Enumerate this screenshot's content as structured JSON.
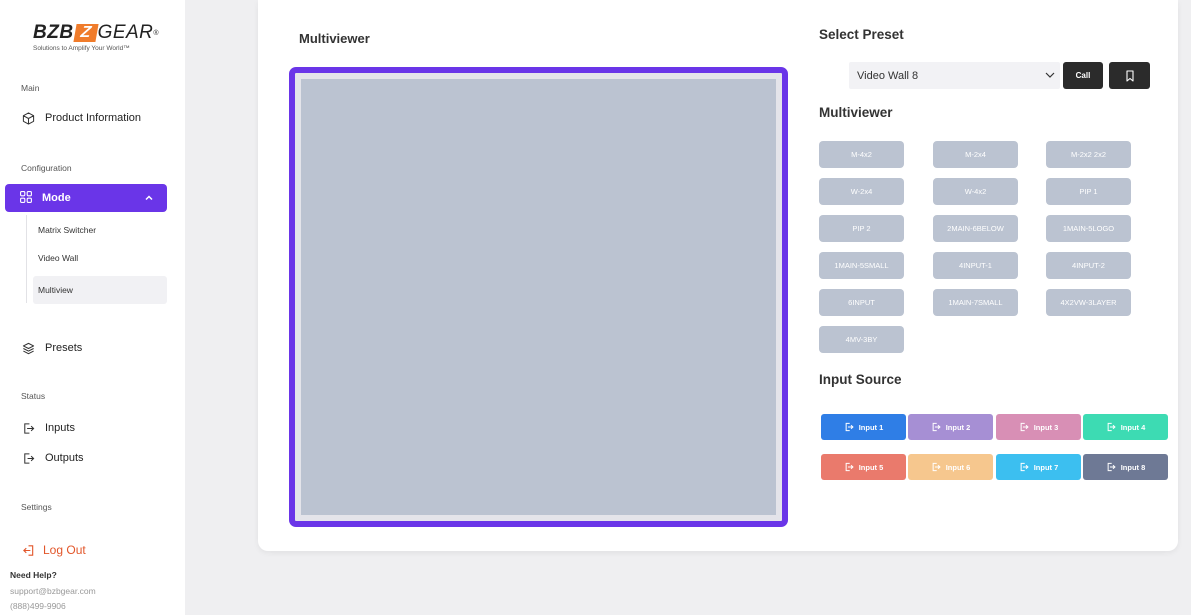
{
  "brand": {
    "logo_left": "BZB",
    "logo_z": "Z",
    "logo_right": "GEAR",
    "logo_reg": "®",
    "tagline": "Solutions to Amplify Your World™"
  },
  "sidebar": {
    "sections": {
      "main": "Main",
      "configuration": "Configuration",
      "status": "Status",
      "settings": "Settings"
    },
    "product_information": "Product Information",
    "mode": "Mode",
    "mode_children": [
      "Matrix Switcher",
      "Video Wall",
      "Multiview"
    ],
    "active_child": "Multiview",
    "presets": "Presets",
    "inputs": "Inputs",
    "outputs": "Outputs",
    "logout": "Log Out",
    "help": {
      "title": "Need Help?",
      "email": "support@bzbgear.com",
      "phone": "(888)499-9906"
    }
  },
  "main": {
    "multiviewer_title": "Multiviewer",
    "select_preset_title": "Select Preset",
    "preset_value": "Video Wall 8",
    "call_label": "Call",
    "multiviewer_section_title": "Multiviewer",
    "layouts": [
      "M-4x2",
      "M-2x4",
      "M-2x2 2x2",
      "W-2x4",
      "W-4x2",
      "PIP 1",
      "PIP 2",
      "2MAIN-6BELOW",
      "1MAIN-5LOGO",
      "1MAIN-5SMALL",
      "4INPUT-1",
      "4INPUT-2",
      "6INPUT",
      "1MAIN-7SMALL",
      "4X2VW-3LAYER",
      "4MV-3BY"
    ],
    "input_source_title": "Input Source",
    "inputs": [
      {
        "label": "Input 1",
        "color": "#2f7ee6"
      },
      {
        "label": "Input 2",
        "color": "#a68fd4"
      },
      {
        "label": "Input 3",
        "color": "#d88fb5"
      },
      {
        "label": "Input 4",
        "color": "#3ddbb3"
      },
      {
        "label": "Input 5",
        "color": "#ea7a6c"
      },
      {
        "label": "Input 6",
        "color": "#f6c78e"
      },
      {
        "label": "Input 7",
        "color": "#3cbff0"
      },
      {
        "label": "Input 8",
        "color": "#6e7995"
      }
    ]
  },
  "colors": {
    "accent": "#6a35e8",
    "preview_fill": "#bbc3d1",
    "layout_button": "#bbc3d1",
    "logout": "#e2562a"
  }
}
